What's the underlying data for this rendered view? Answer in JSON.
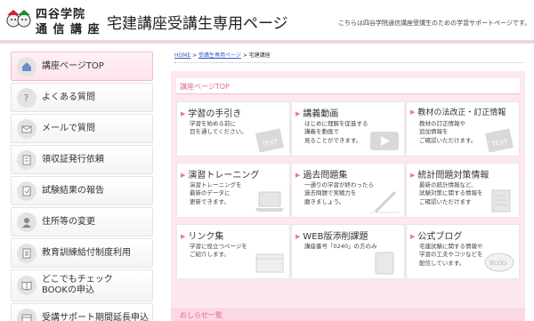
{
  "header": {
    "logo_line1": "四谷学院",
    "logo_line2": "通 信 講 座",
    "title": "宅建講座受講生専用ページ",
    "note": "こちらは四谷学院通信講座受講生のための学習サポートページです。"
  },
  "sidebar": {
    "items": [
      {
        "label": "講座ページTOP",
        "icon": "home-icon"
      },
      {
        "label": "よくある質問",
        "icon": "question-icon"
      },
      {
        "label": "メールで質問",
        "icon": "mail-icon"
      },
      {
        "label": "領収証発行依頼",
        "icon": "receipt-icon"
      },
      {
        "label": "試験結果の報告",
        "icon": "report-icon"
      },
      {
        "label": "住所等の変更",
        "icon": "address-icon"
      },
      {
        "label": "教育訓練給付制度利用",
        "icon": "document-icon"
      },
      {
        "label": "どこでもチェック\nBOOKの申込",
        "icon": "book-icon"
      },
      {
        "label": "受講サポート期間延長申込",
        "icon": "calendar-icon"
      }
    ]
  },
  "breadcrumb": {
    "home": "HOME",
    "sep1": " > ",
    "student_page": "受講生専用ページ",
    "sep2": " > ",
    "current": "宅建講座"
  },
  "main": {
    "section_title": "講座ページTOP",
    "cards": [
      {
        "title": "学習の手引き",
        "desc": "学習を始める前に\n目を通してください。",
        "art": "TEXT"
      },
      {
        "title": "講義動画",
        "desc": "はじめに理解を促進する\n講義を動画で\n見ることができます。",
        "art": "play"
      },
      {
        "title": "教材の法改正・訂正情報",
        "desc": "教材の訂正情報や\n追加情報を\nご確認いただけます。",
        "art": "TEXT"
      },
      {
        "title": "演習トレーニング",
        "desc": "演習トレーニングを\n最新のデータに\n更新できます。",
        "art": "laptop"
      },
      {
        "title": "過去問題集",
        "desc": "一通りの学習が終わったら\n過去問題で実戦力を\n磨きましょう。",
        "art": "pen"
      },
      {
        "title": "統計問題対策情報",
        "desc": "最新の統計情報など、\n試験対策に関する情報を\nご確認いただけます",
        "art": "doc"
      },
      {
        "title": "リンク集",
        "desc": "学習に役立つページを\nご紹介します。",
        "art": "link"
      },
      {
        "title": "WEB版添削課題",
        "desc": "講座番号「0240」の方のみ",
        "art": "tablet"
      },
      {
        "title": "公式ブログ",
        "desc": "宅建試験に関する情報や\n学習の工夫やコツなどを\n配信しています。",
        "art": "BLOG"
      }
    ],
    "news_title": "おしらせ一覧"
  },
  "colors": {
    "accent": "#e06d8d",
    "panel_bg": "#fde8ee",
    "active_nav_bg": "#fde3ea",
    "link": "#3b59c8"
  }
}
